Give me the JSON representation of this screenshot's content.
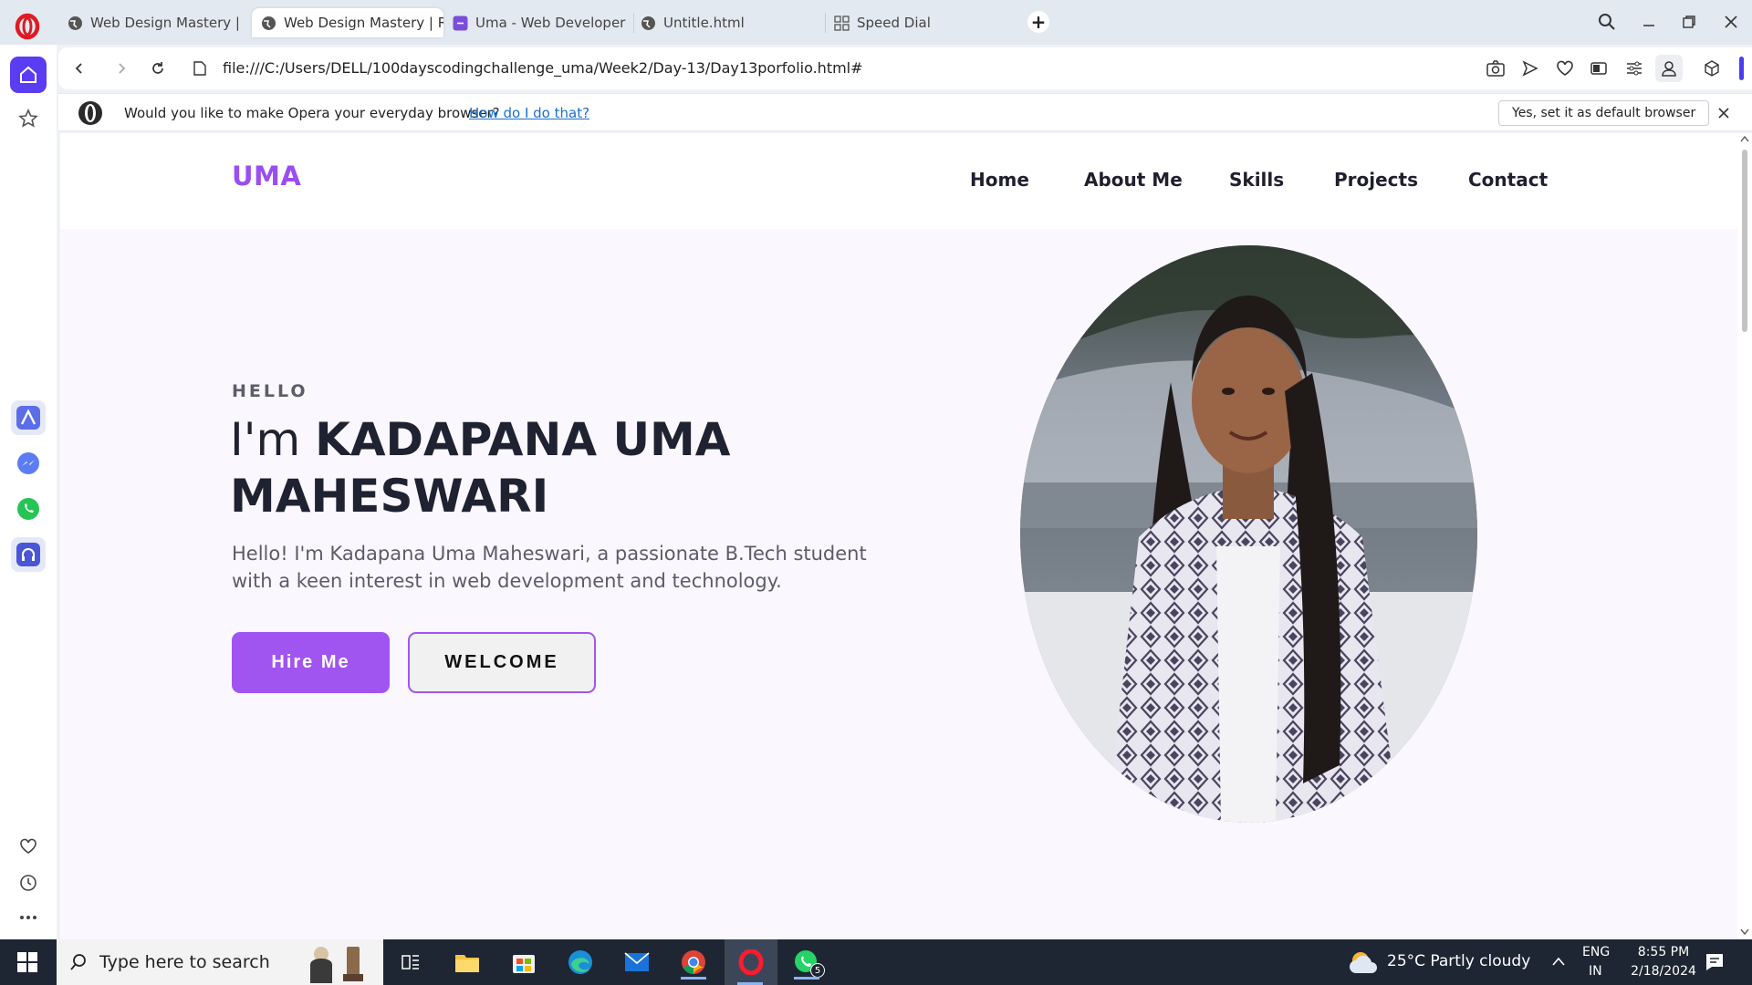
{
  "browser": {
    "tabs": [
      {
        "title": "Web Design Mastery | Res",
        "active": false
      },
      {
        "title": "Web Design Mastery | Res",
        "active": true
      },
      {
        "title": "Uma - Web Developer",
        "active": false
      },
      {
        "title": "Untitle.html",
        "active": false
      },
      {
        "title": "Speed Dial",
        "active": false
      }
    ],
    "url": "file:///C:/Users/DELL/100dayscodingchallenge_uma/Week2/Day-13/Day13porfolio.html#",
    "infobar": {
      "message": "Would you like to make Opera your everyday browser?",
      "link": "How do I do that?",
      "button": "Yes, set it as default browser"
    },
    "accent_color": "#5a3df2"
  },
  "site": {
    "logo": "UMA",
    "nav": [
      "Home",
      "About Me",
      "Skills",
      "Projects",
      "Contact"
    ],
    "hero": {
      "greeting": "HELLO",
      "headline_prefix": "I'm",
      "headline_name": "KADAPANA UMA MAHESWARI",
      "intro": "Hello! I'm Kadapana Uma Maheswari, a passionate B.Tech student with a keen interest in web development and technology.",
      "primary_button": "Hire Me",
      "secondary_button": "WELCOME"
    },
    "brand_color": "#a055f0"
  },
  "taskbar": {
    "search_placeholder": "Type here to search",
    "weather": "25°C  Partly cloudy",
    "language": "ENG",
    "region": "IN",
    "time": "8:55 PM",
    "date": "2/18/2024",
    "whatsapp_badge": "5"
  }
}
